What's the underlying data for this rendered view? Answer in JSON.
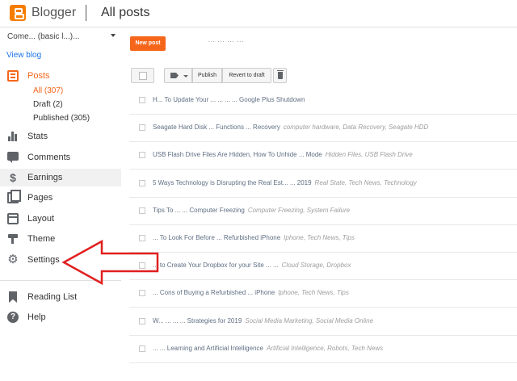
{
  "header": {
    "brand": "Blogger",
    "page_title": "All posts"
  },
  "sidebar": {
    "blog_name": "Come... (basic l...)...",
    "view_blog": "View blog",
    "posts": {
      "label": "Posts",
      "sub": [
        {
          "label": "All (307)",
          "active": true
        },
        {
          "label": "Draft (2)"
        },
        {
          "label": "Published (305)"
        }
      ]
    },
    "items": [
      {
        "label": "Stats",
        "icon": "bar-chart-icon"
      },
      {
        "label": "Comments",
        "icon": "comment-icon"
      },
      {
        "label": "Earnings",
        "icon": "dollar-icon"
      },
      {
        "label": "Pages",
        "icon": "pages-icon"
      },
      {
        "label": "Layout",
        "icon": "layout-icon"
      },
      {
        "label": "Theme",
        "icon": "paint-roller-icon"
      },
      {
        "label": "Settings",
        "icon": "gear-icon"
      }
    ],
    "secondary": [
      {
        "label": "Reading List",
        "icon": "bookmark-icon"
      },
      {
        "label": "Help",
        "icon": "help-icon"
      }
    ]
  },
  "toolbar": {
    "new_post": "New post",
    "publish": "Publish",
    "revert": "Revert to draft"
  },
  "new_post_hint": "... ... ... ...",
  "posts": [
    {
      "title": "H... To Update Your ... ... ... ... Google Plus Shutdown",
      "labels": ""
    },
    {
      "title": "Seagate Hard Disk ... Functions ... Recovery",
      "labels": "computer hardware, Data Recovery, Seagate HDD"
    },
    {
      "title": "USB Flash Drive Files Are Hidden, How To Unhide ... Mode",
      "labels": "Hidden Files, USB Flash Drive"
    },
    {
      "title": "5 Ways Technology is Disrupting the Real Est... ... 2019",
      "labels": "Real State, Tech News, Technology"
    },
    {
      "title": "Tips To ... ... Computer Freezing",
      "labels": "Computer Freezing, System Failure"
    },
    {
      "title": "... To Look For Before ... Refurbished iPhone",
      "labels": "Iphone, Tech News, Tips"
    },
    {
      "title": "... to Create Your Dropbox for your Site ... ...",
      "labels": "Cloud Storage, Dropbox"
    },
    {
      "title": "... Cons of Buying a Refurbished ... iPhone",
      "labels": "Iphone, Tech News, Tips"
    },
    {
      "title": "W... ... ... ... Strategies for 2019",
      "labels": "Social Media Marketing, Social Media Online"
    },
    {
      "title": "... ... Learning and Artificial Intelligence",
      "labels": "Artificial Intelligence, Robots, Tech News"
    }
  ],
  "colors": {
    "accent": "#f5661b",
    "arrow": "#e02020"
  }
}
